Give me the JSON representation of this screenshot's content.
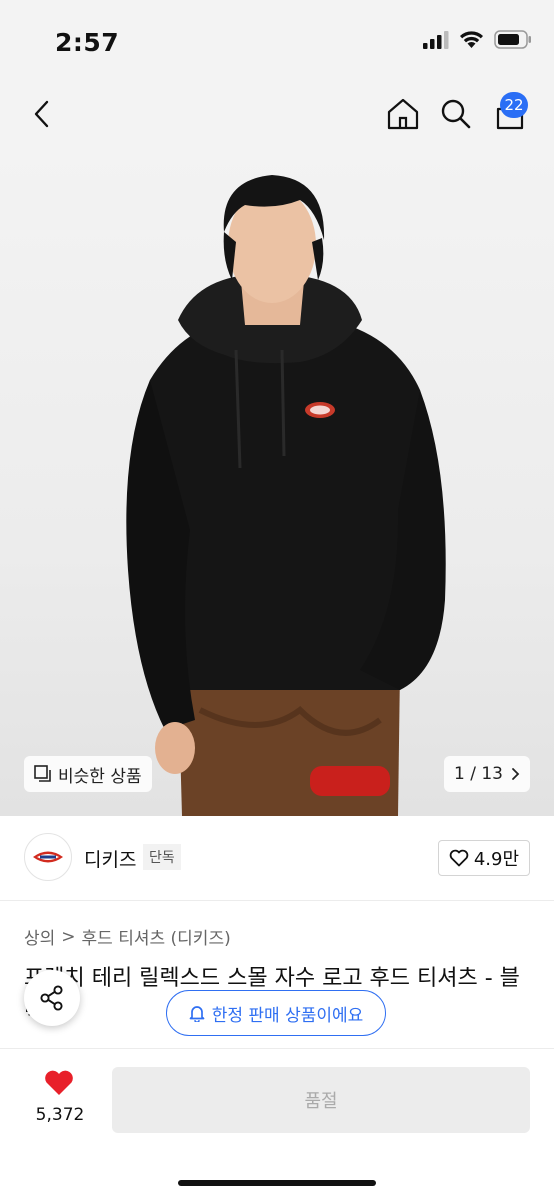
{
  "status": {
    "time": "2:57"
  },
  "nav": {
    "cart_count": "22"
  },
  "gallery": {
    "similar_label": "비슷한 상품",
    "page_indicator": "1 / 13"
  },
  "brand": {
    "name": "디키즈",
    "exclusive_badge": "단독",
    "likes": "4.9만"
  },
  "breadcrumb": {
    "category": "상의",
    "separator": ">",
    "subcategory": "후드 티셔츠 (디키즈)"
  },
  "product": {
    "title": "프렌치 테리 릴렉스드 스몰 자수 로고 후드 티셔츠 - 블랙"
  },
  "limited_notice": "한정 판매 상품이에요",
  "bottom": {
    "like_count": "5,372",
    "soldout_label": "품절"
  },
  "colors": {
    "accent": "#2a6ef5",
    "heart": "#e8202a"
  }
}
